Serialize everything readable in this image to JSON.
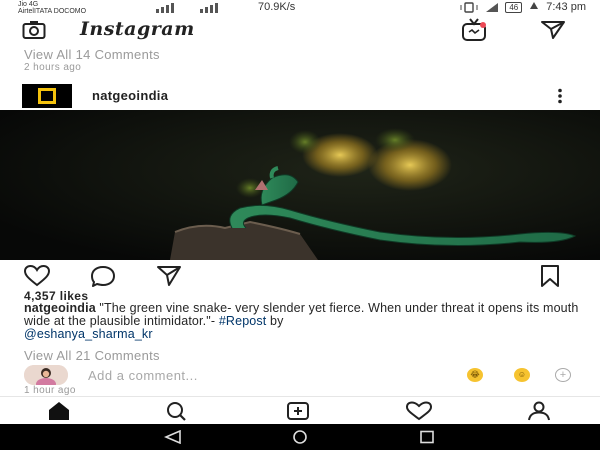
{
  "status": {
    "carrier1": "Jio 4G",
    "carrier2": "AirtelITATA DOCOMO",
    "speed": "70.9K/s",
    "battery": "46",
    "time": "7:43 pm"
  },
  "app": {
    "brand": "Instagram"
  },
  "previous_post": {
    "view_comments": "View All 14 Comments",
    "time": "2 hours ago"
  },
  "post": {
    "username": "natgeoindia",
    "likes": "4,357 likes",
    "caption_user": "natgeoindia",
    "caption_text": " \"The green vine snake- very slender yet fierce. When under threat it opens its mouth wide at the plausible intimidator.\"- ",
    "hashtag": "#Repost",
    "caption_by": " by",
    "mention": "@eshanya_sharma_kr",
    "view_comments": "View All 21 Comments",
    "add_comment_placeholder": "Add a comment...",
    "time": "1 hour ago"
  },
  "emojis": [
    "laughing-emoji",
    "smiling-emoji",
    "add-emoji"
  ],
  "nav": [
    "home",
    "search",
    "new-post",
    "activity",
    "profile"
  ],
  "colors": {
    "accent": "#f4c20d",
    "link": "#003569",
    "muted": "#9a9a9a"
  }
}
